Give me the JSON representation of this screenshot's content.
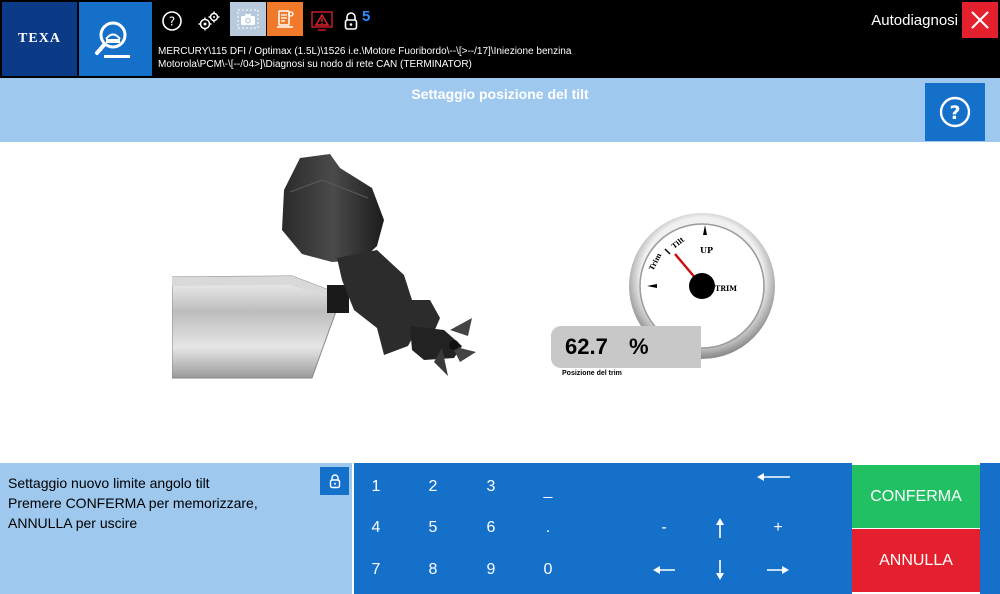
{
  "app": {
    "brand": "TEXA"
  },
  "header": {
    "path_line1": "MERCURY\\115 DFI / Optimax (1.5L)\\1526 i.e.\\Motore Fuoribordo\\--\\[>--/17]\\Iniezione benzina",
    "path_line2": "Motorola\\PCM\\-\\[--/04>]\\Diagnosi su nodo di rete CAN (TERMINATOR)",
    "section": "Autodiagnosi",
    "badge_count": "5"
  },
  "page": {
    "title": "Settaggio posizione del tilt"
  },
  "gauge": {
    "value": "62.7",
    "unit": "%",
    "label": "Posizione del trim",
    "dial_label_trim": "Trim",
    "dial_label_tilt": "Tilt",
    "dial_label_up": "UP",
    "dial_label_center": "TRIM"
  },
  "message": {
    "line1": "Settaggio nuovo limite angolo tilt",
    "line2": "Premere CONFERMA per memorizzare,",
    "line3": "ANNULLA per uscire"
  },
  "keypad": {
    "k1": "1",
    "k2": "2",
    "k3": "3",
    "k_dash": "_",
    "k4": "4",
    "k5": "5",
    "k6": "6",
    "k_dot": ".",
    "k7": "7",
    "k8": "8",
    "k9": "9",
    "k0": "0",
    "k_minus": "-",
    "k_plus": "+"
  },
  "actions": {
    "confirm": "CONFERMA",
    "cancel": "ANNULLA"
  },
  "colors": {
    "accent_blue": "#1570c9",
    "light_blue": "#9ec8ee",
    "confirm_green": "#20c063",
    "cancel_red": "#e5202e"
  }
}
